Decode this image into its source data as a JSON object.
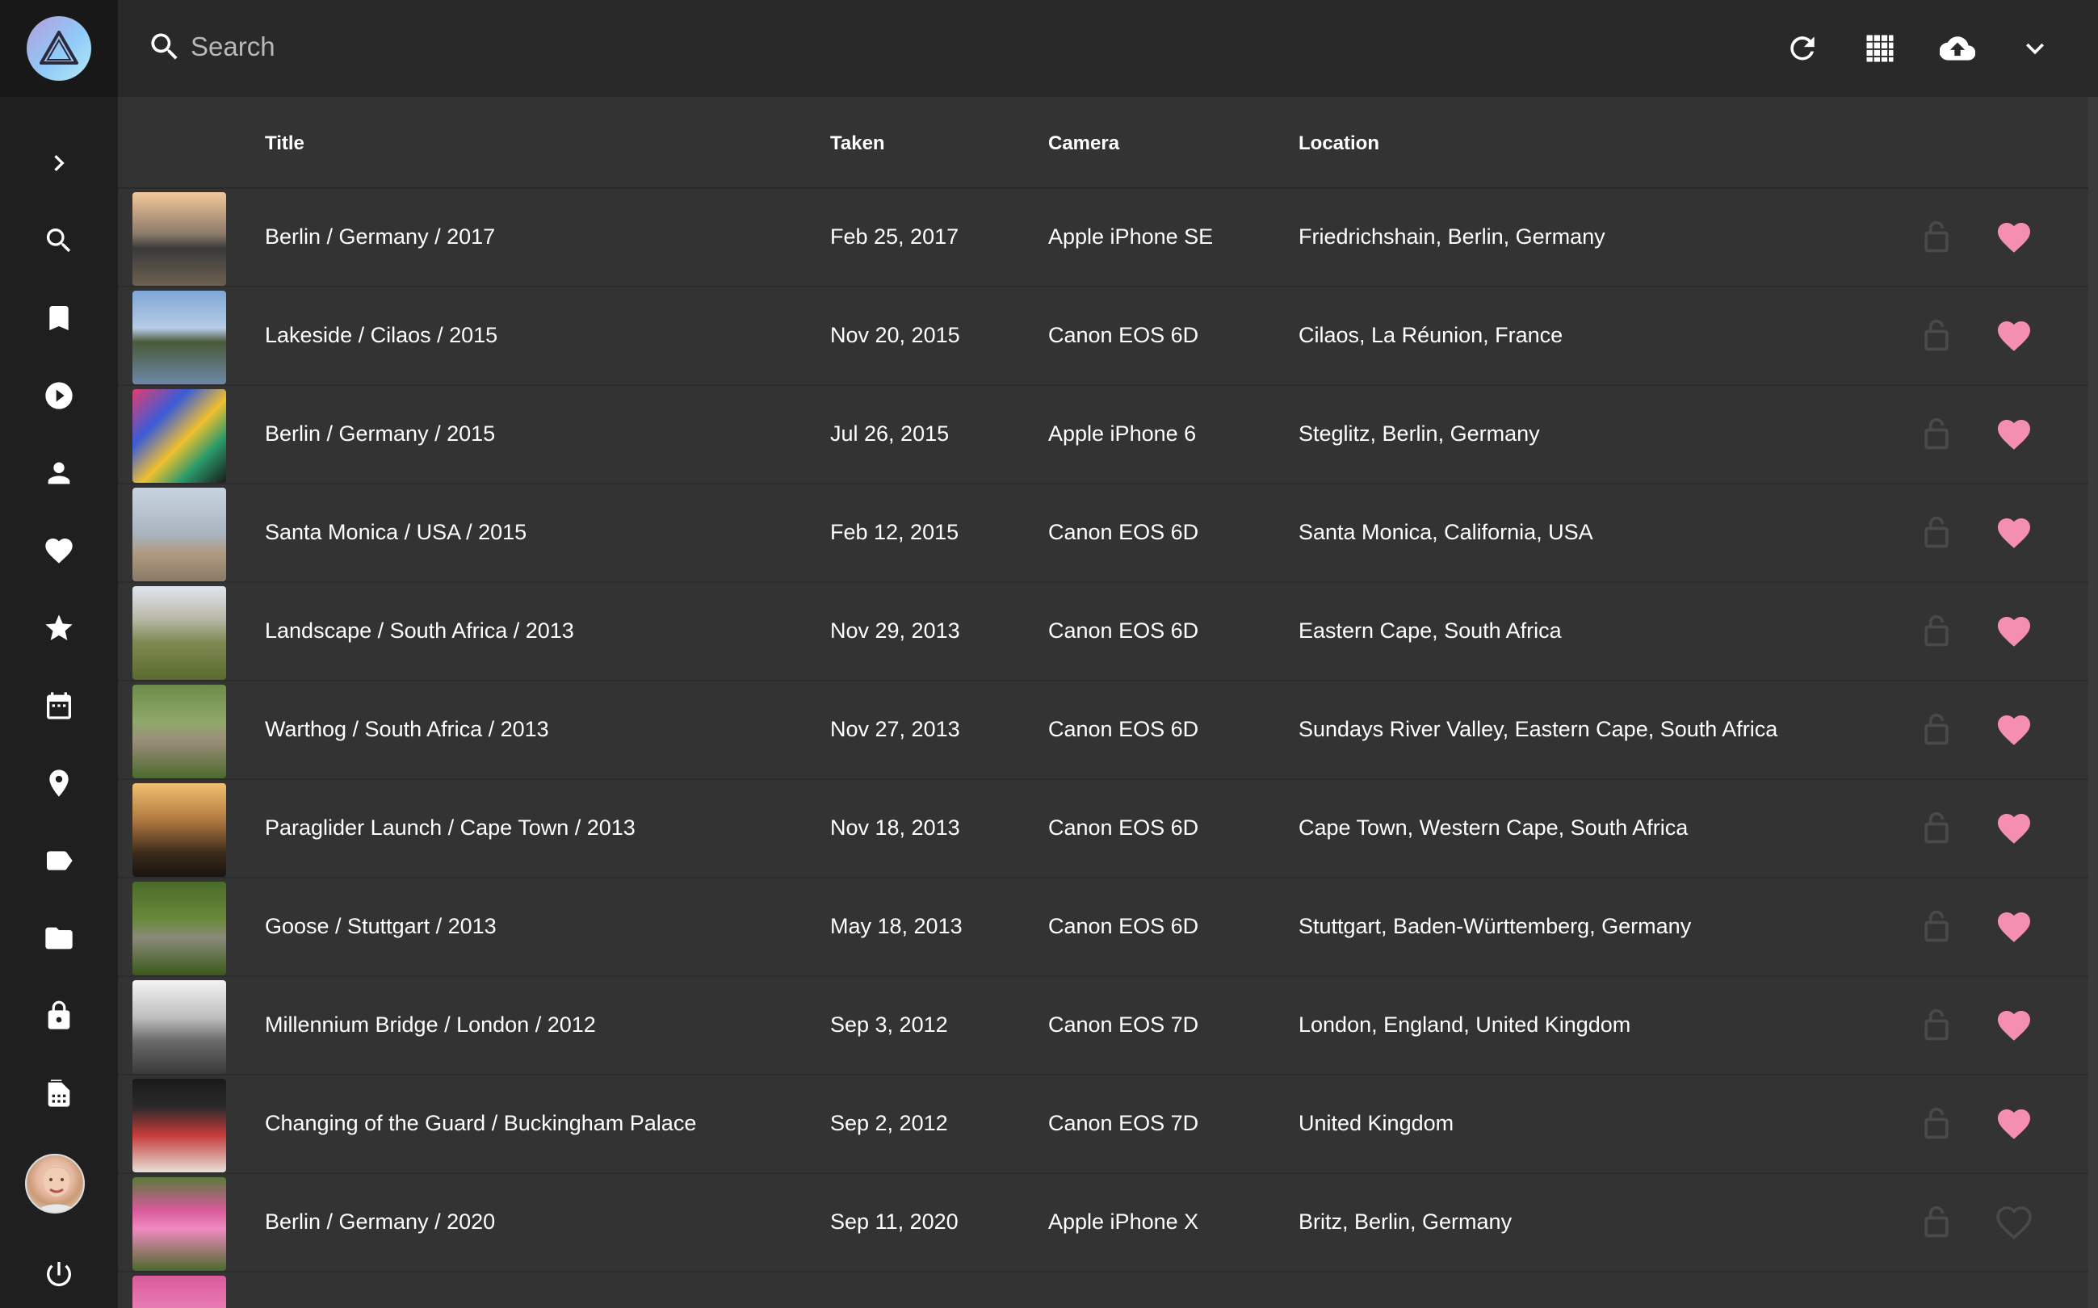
{
  "search": {
    "placeholder": "Search"
  },
  "toolbar": {
    "icons": [
      "refresh-icon",
      "grid-view-icon",
      "upload-icon",
      "chevron-down-icon"
    ]
  },
  "sidebar": {
    "items": [
      {
        "name": "expand",
        "icon": "chevron-right-icon"
      },
      {
        "name": "search",
        "icon": "search-icon"
      },
      {
        "name": "albums",
        "icon": "bookmark-icon"
      },
      {
        "name": "videos",
        "icon": "play-circle-icon"
      },
      {
        "name": "people",
        "icon": "person-icon"
      },
      {
        "name": "favorites",
        "icon": "heart-icon"
      },
      {
        "name": "moments",
        "icon": "star-icon"
      },
      {
        "name": "calendar",
        "icon": "calendar-icon"
      },
      {
        "name": "places",
        "icon": "location-pin-icon"
      },
      {
        "name": "labels",
        "icon": "label-icon"
      },
      {
        "name": "folders",
        "icon": "folder-icon"
      },
      {
        "name": "private",
        "icon": "lock-icon"
      },
      {
        "name": "library",
        "icon": "film-icon"
      }
    ]
  },
  "table": {
    "columns": [
      "Title",
      "Taken",
      "Camera",
      "Location"
    ],
    "rows": [
      {
        "title": "Berlin / Germany / 2017",
        "taken": "Feb 25, 2017",
        "camera": "Apple iPhone SE",
        "location": "Friedrichshain, Berlin, Germany",
        "favorite": true
      },
      {
        "title": "Lakeside / Cilaos / 2015",
        "taken": "Nov 20, 2015",
        "camera": "Canon EOS 6D",
        "location": "Cilaos, La Réunion, France",
        "favorite": true
      },
      {
        "title": "Berlin / Germany / 2015",
        "taken": "Jul 26, 2015",
        "camera": "Apple iPhone 6",
        "location": "Steglitz, Berlin, Germany",
        "favorite": true
      },
      {
        "title": "Santa Monica / USA / 2015",
        "taken": "Feb 12, 2015",
        "camera": "Canon EOS 6D",
        "location": "Santa Monica, California, USA",
        "favorite": true
      },
      {
        "title": "Landscape / South Africa / 2013",
        "taken": "Nov 29, 2013",
        "camera": "Canon EOS 6D",
        "location": "Eastern Cape, South Africa",
        "favorite": true
      },
      {
        "title": "Warthog / South Africa / 2013",
        "taken": "Nov 27, 2013",
        "camera": "Canon EOS 6D",
        "location": "Sundays River Valley, Eastern Cape, South Africa",
        "favorite": true
      },
      {
        "title": "Paraglider Launch / Cape Town / 2013",
        "taken": "Nov 18, 2013",
        "camera": "Canon EOS 6D",
        "location": "Cape Town, Western Cape, South Africa",
        "favorite": true
      },
      {
        "title": "Goose / Stuttgart / 2013",
        "taken": "May 18, 2013",
        "camera": "Canon EOS 6D",
        "location": "Stuttgart, Baden-Württemberg, Germany",
        "favorite": true
      },
      {
        "title": "Millennium Bridge / London / 2012",
        "taken": "Sep 3, 2012",
        "camera": "Canon EOS 7D",
        "location": "London, England, United Kingdom",
        "favorite": true
      },
      {
        "title": "Changing of the Guard / Buckingham Palace",
        "taken": "Sep 2, 2012",
        "camera": "Canon EOS 7D",
        "location": "United Kingdom",
        "favorite": true
      },
      {
        "title": "Berlin / Germany / 2020",
        "taken": "Sep 11, 2020",
        "camera": "Apple iPhone X",
        "location": "Britz, Berlin, Germany",
        "favorite": false
      }
    ]
  },
  "colors": {
    "favorite": "#f48fb1",
    "sidebar_bg": "#1f1f1f",
    "toolbar_bg": "#292929",
    "table_bg": "#333333"
  }
}
